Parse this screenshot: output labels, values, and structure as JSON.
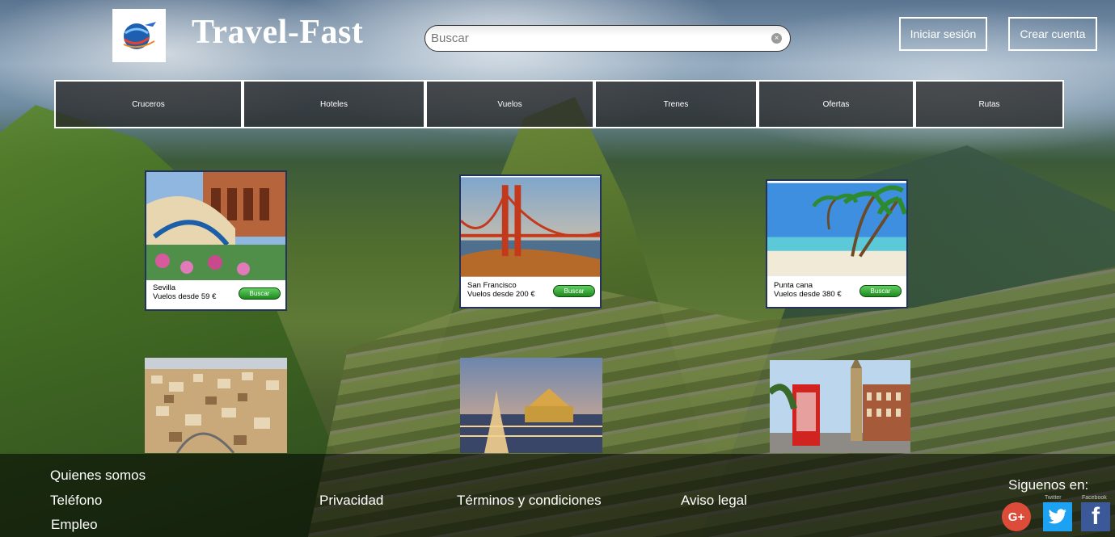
{
  "brand": {
    "name": "Travel-Fast"
  },
  "search": {
    "placeholder": "Buscar",
    "value": ""
  },
  "header": {
    "login_label": "Iniciar sesión",
    "signup_label": "Crear cuenta"
  },
  "nav": {
    "tabs": [
      {
        "label": "Cruceros"
      },
      {
        "label": "Hoteles"
      },
      {
        "label": "Vuelos"
      },
      {
        "label": "Trenes"
      },
      {
        "label": "Ofertas"
      },
      {
        "label": "Rutas"
      }
    ]
  },
  "destinations": [
    {
      "city": "Sevilla",
      "price": "Vuelos desde 59 €",
      "button": "Buscar"
    },
    {
      "city": "San Francisco",
      "price": "Vuelos desde 200 €",
      "button": "Buscar"
    },
    {
      "city": "Punta cana",
      "price": "Vuelos desde 380 €",
      "button": "Buscar"
    }
  ],
  "footer": {
    "links": {
      "about": "Quienes somos",
      "phone": "Teléfono",
      "jobs": "Empleo",
      "privacy": "Privacidad",
      "terms": "Términos y condiciones",
      "legal": "Aviso legal"
    },
    "follow": "Siguenos en:",
    "social_captions": {
      "twitter": "Twitter",
      "facebook": "Facebook"
    }
  },
  "icons": {
    "logo": "globe-airplane-logo",
    "clear": "clear-icon",
    "googleplus": "google-plus-icon",
    "twitter": "twitter-icon",
    "facebook": "facebook-icon"
  },
  "colors": {
    "buy_button": "#1f8a1f",
    "card_border": "#23335a",
    "googleplus": "#dd4b39",
    "twitter": "#1da1f2",
    "facebook": "#3b5998"
  }
}
